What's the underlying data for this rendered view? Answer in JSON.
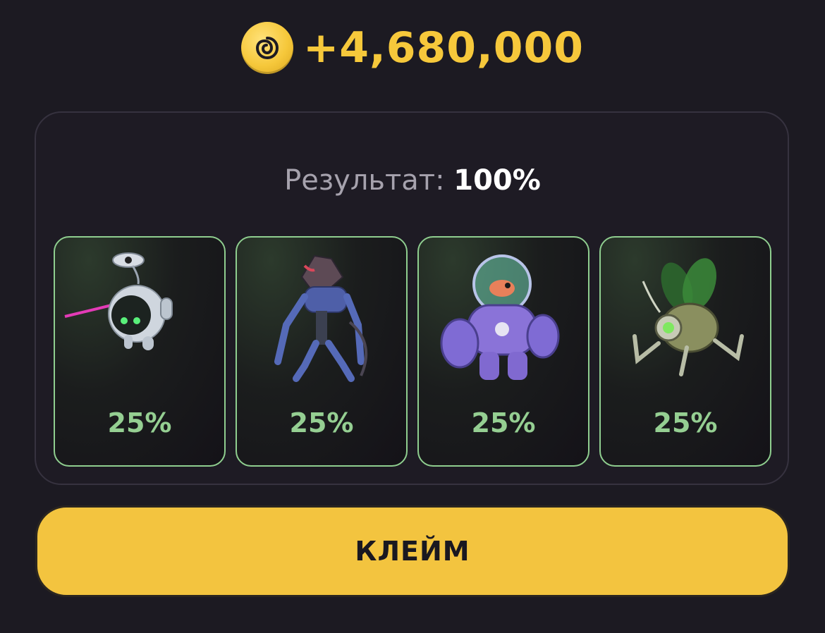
{
  "reward": {
    "amount": "+4,680,000",
    "icon": "coin-icon",
    "color": "#f6c83b"
  },
  "result": {
    "label": "Результат:",
    "value": "100%"
  },
  "cards": [
    {
      "icon": "robot-orb-drone-icon",
      "percent": "25%"
    },
    {
      "icon": "cyborg-rat-creature-icon",
      "percent": "25%"
    },
    {
      "icon": "diving-suit-mech-fish-icon",
      "percent": "25%"
    },
    {
      "icon": "mechanical-fly-drone-icon",
      "percent": "25%"
    }
  ],
  "claim_button": {
    "label": "КЛЕЙМ",
    "color": "#f3c43f"
  },
  "colors": {
    "background": "#1c1a22",
    "card_border": "#8fce8f",
    "percent_text": "#95cf92"
  }
}
